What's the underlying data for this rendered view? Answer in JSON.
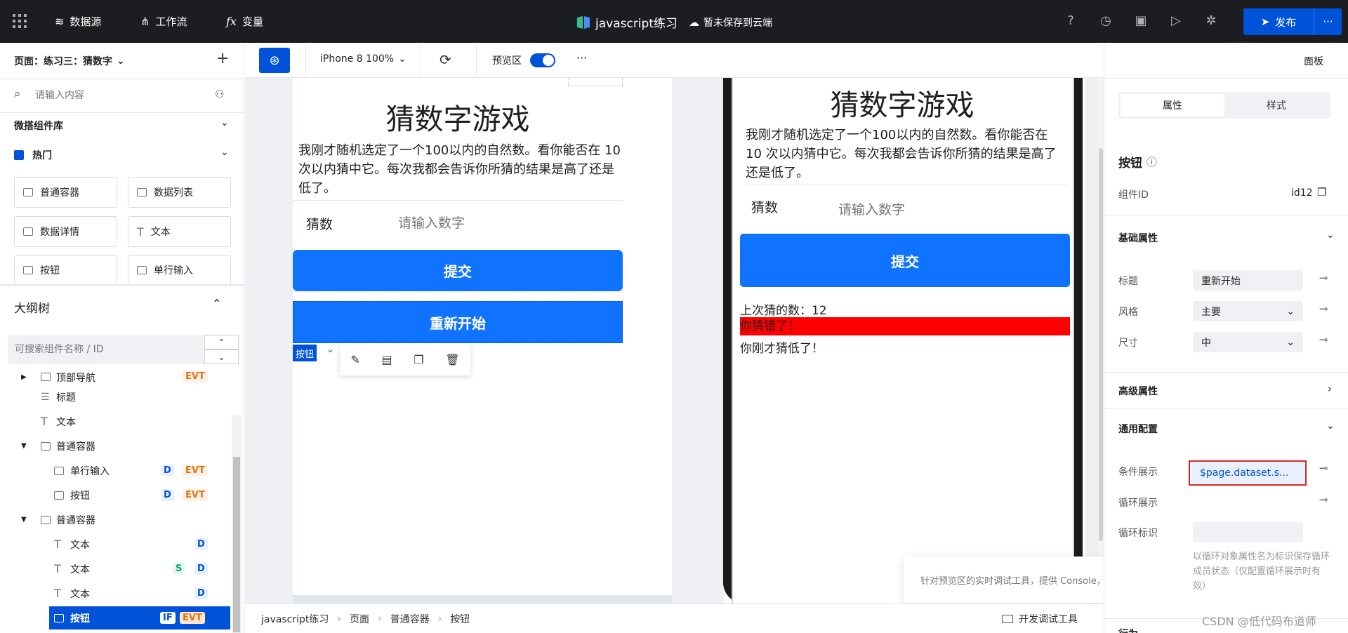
{
  "topbar": {
    "datasource": "数据源",
    "workflow": "工作流",
    "variables": "变量",
    "app_title": "javascript练习",
    "save_status": "暂未保存到云端",
    "publish": "发布",
    "more": "···"
  },
  "left": {
    "page_selector": "页面：练习三：猜数字",
    "search_placeholder": "请输入内容",
    "library_title": "微搭组件库",
    "hot_title": "热门",
    "components": [
      "普通容器",
      "数据列表",
      "数据详情",
      "文本",
      "按钮",
      "单行输入"
    ],
    "outline_title": "大纲树",
    "outline_search_placeholder": "可搜索组件名称 / ID",
    "tree": [
      {
        "label": "顶部导航",
        "badges": [
          "EVT"
        ]
      },
      {
        "label": "标题",
        "badges": []
      },
      {
        "label": "文本",
        "badges": []
      },
      {
        "label": "普通容器",
        "badges": []
      },
      {
        "label": "单行输入",
        "badges": [
          "D",
          "EVT"
        ]
      },
      {
        "label": "按钮",
        "badges": [
          "D",
          "EVT"
        ]
      },
      {
        "label": "普通容器",
        "badges": []
      },
      {
        "label": "文本",
        "badges": [
          "D"
        ]
      },
      {
        "label": "文本",
        "badges": [
          "S",
          "D"
        ]
      },
      {
        "label": "文本",
        "badges": [
          "D"
        ]
      },
      {
        "label": "按钮",
        "badges": [
          "IF",
          "EVT"
        ]
      }
    ]
  },
  "toolbar": {
    "device": "iPhone 8 100%",
    "preview_label": "预览区",
    "more": "···"
  },
  "editor": {
    "title": "猜数字游戏",
    "intro": "我刚才随机选定了一个100以内的自然数。看你能否在 10 次以内猜中它。每次我都会告诉你所猜的结果是高了还是低了。",
    "guess_label": "猜数",
    "guess_placeholder": "请输入数字",
    "submit": "提交",
    "restart": "重新开始",
    "selected_tag": "按钮"
  },
  "preview": {
    "title": "猜数字游戏",
    "intro": "我刚才随机选定了一个100以内的自然数。看你能否在 10 次以内猜中它。每次我都会告诉你所猜的结果是高了还是低了。",
    "guess_label": "猜数",
    "guess_placeholder": "请输入数字",
    "submit": "提交",
    "last_guess": "上次猜的数：12",
    "wrong": "你猜错了！",
    "too_low": "你刚才猜低了！"
  },
  "tooltip": "针对预览区的实时调试工具，提供 Console，网络等功能",
  "bottombar": {
    "crumbs": [
      "javascript练习",
      "页面",
      "普通容器",
      "按钮"
    ],
    "dev_tools": "开发调试工具"
  },
  "right": {
    "panel_button": "面板",
    "tabs": [
      "属性",
      "样式"
    ],
    "component_name": "按钮",
    "component_id_label": "组件ID",
    "component_id": "id12",
    "basic_title": "基础属性",
    "title_label": "标题",
    "title_value": "重新开始",
    "style_label": "风格",
    "style_value": "主要",
    "size_label": "尺寸",
    "size_value": "中",
    "advanced_title": "高级属性",
    "common_title": "通用配置",
    "cond_label": "条件展示",
    "cond_value": "$page.dataset.s...",
    "loop_label": "循环展示",
    "loop_id_label": "循环标识",
    "loop_hint": "以循环对象属性名为标识保存循环成员状态（仅配置循环展示时有效）",
    "behavior_title": "行为"
  },
  "watermark": "CSDN @低代码布道师"
}
